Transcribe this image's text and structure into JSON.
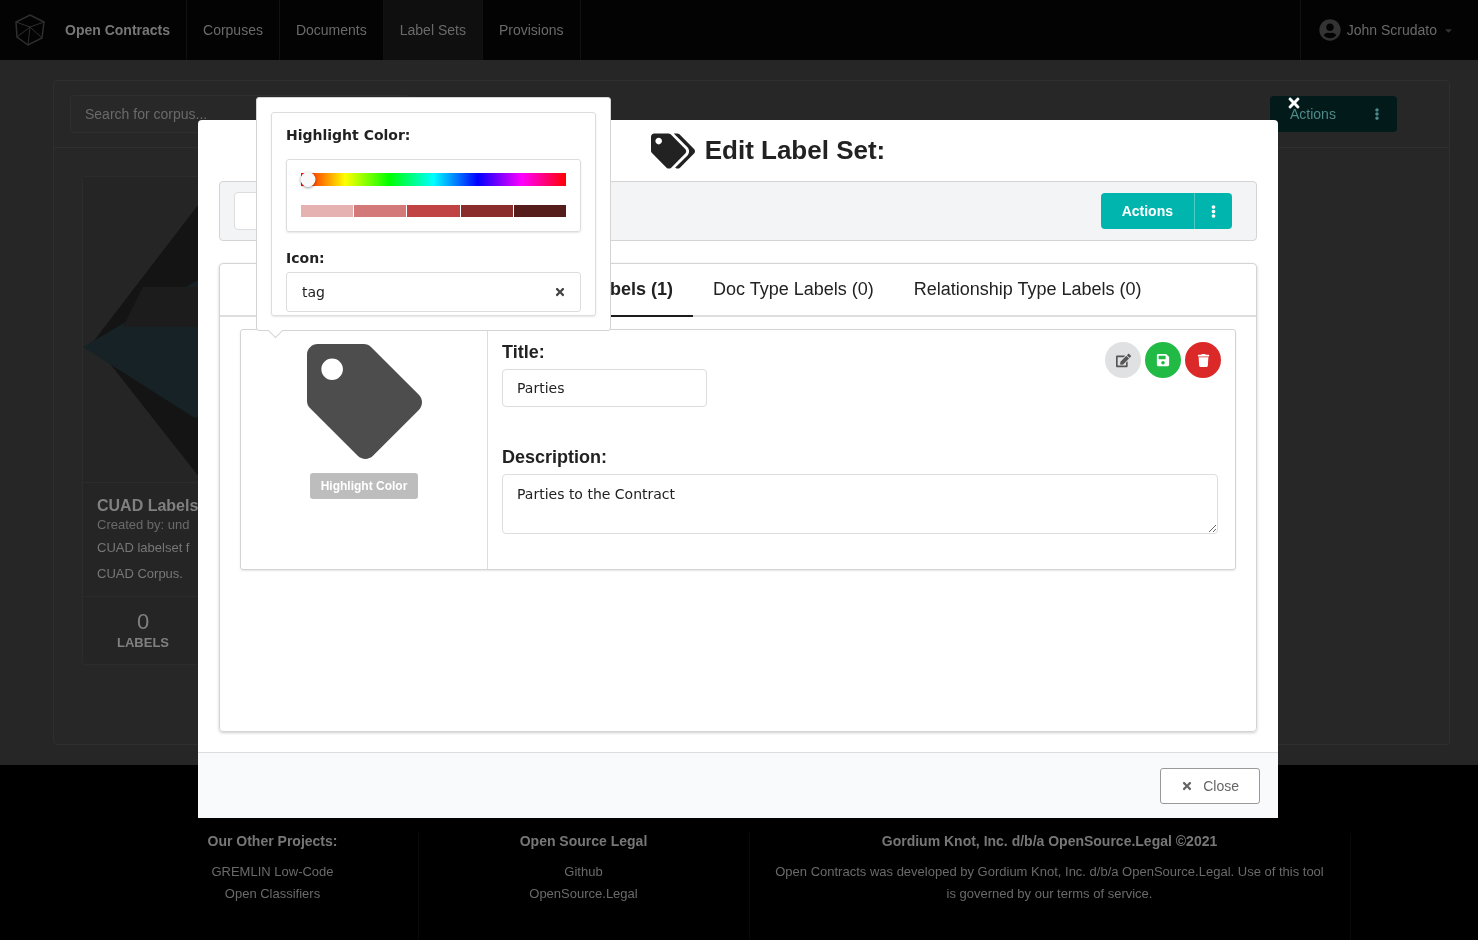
{
  "navbar": {
    "brand": "Open Contracts",
    "items": [
      {
        "label": "Corpuses",
        "selected": false
      },
      {
        "label": "Documents",
        "selected": false
      },
      {
        "label": "Label Sets",
        "selected": true
      },
      {
        "label": "Provisions",
        "selected": false
      }
    ],
    "user": "John Scrudato"
  },
  "background_page": {
    "search": {
      "placeholder": "Search for corpus..."
    },
    "actions_button": "Actions",
    "card": {
      "kind": "picture",
      "title": "CUAD Labels",
      "created_by": "Created by: und",
      "description": [
        "CUAD labelset f",
        "CUAD Corpus."
      ],
      "count": "0",
      "count_label": "LABELS"
    }
  },
  "modal": {
    "title": "Edit Label Set:",
    "actions_button": "Actions",
    "tabs": [
      {
        "label": "bels (1)",
        "selected": true
      },
      {
        "label": "Doc Type Labels (0)",
        "selected": false
      },
      {
        "label": "Relationship Type Labels (0)",
        "selected": false
      }
    ],
    "label": {
      "highlight_button": "Highlight Color",
      "title_label": "Title:",
      "title_value": "Parties",
      "description_label": "Description:",
      "description_value": "Parties to the Contract"
    },
    "close_button": "Close"
  },
  "popup": {
    "color_label": "Highlight Color:",
    "hue": {
      "level": 0
    },
    "swatches": [
      {
        "color": "#e6b1b1"
      },
      {
        "color": "#d47979"
      },
      {
        "color": "#c04444"
      },
      {
        "color": "#8a2c2c"
      },
      {
        "color": "#561c1c"
      }
    ],
    "icon_label": "Icon:",
    "icon_value": "tag"
  },
  "footer": {
    "columns": [
      {
        "title": "Our Other Projects:",
        "lines": [
          "GREMLIN Low-Code",
          "Open Classifiers"
        ]
      },
      {
        "title": "Open Source Legal",
        "lines": [
          "Github",
          "OpenSource.Legal"
        ]
      },
      {
        "title": "Gordium Knot, Inc. d/b/a OpenSource.Legal ©2021",
        "lines": [
          "Open Contracts was developed by Gordium Knot, Inc. d/b/a OpenSource.Legal. Use of this tool is governed by our terms of service."
        ]
      }
    ]
  }
}
